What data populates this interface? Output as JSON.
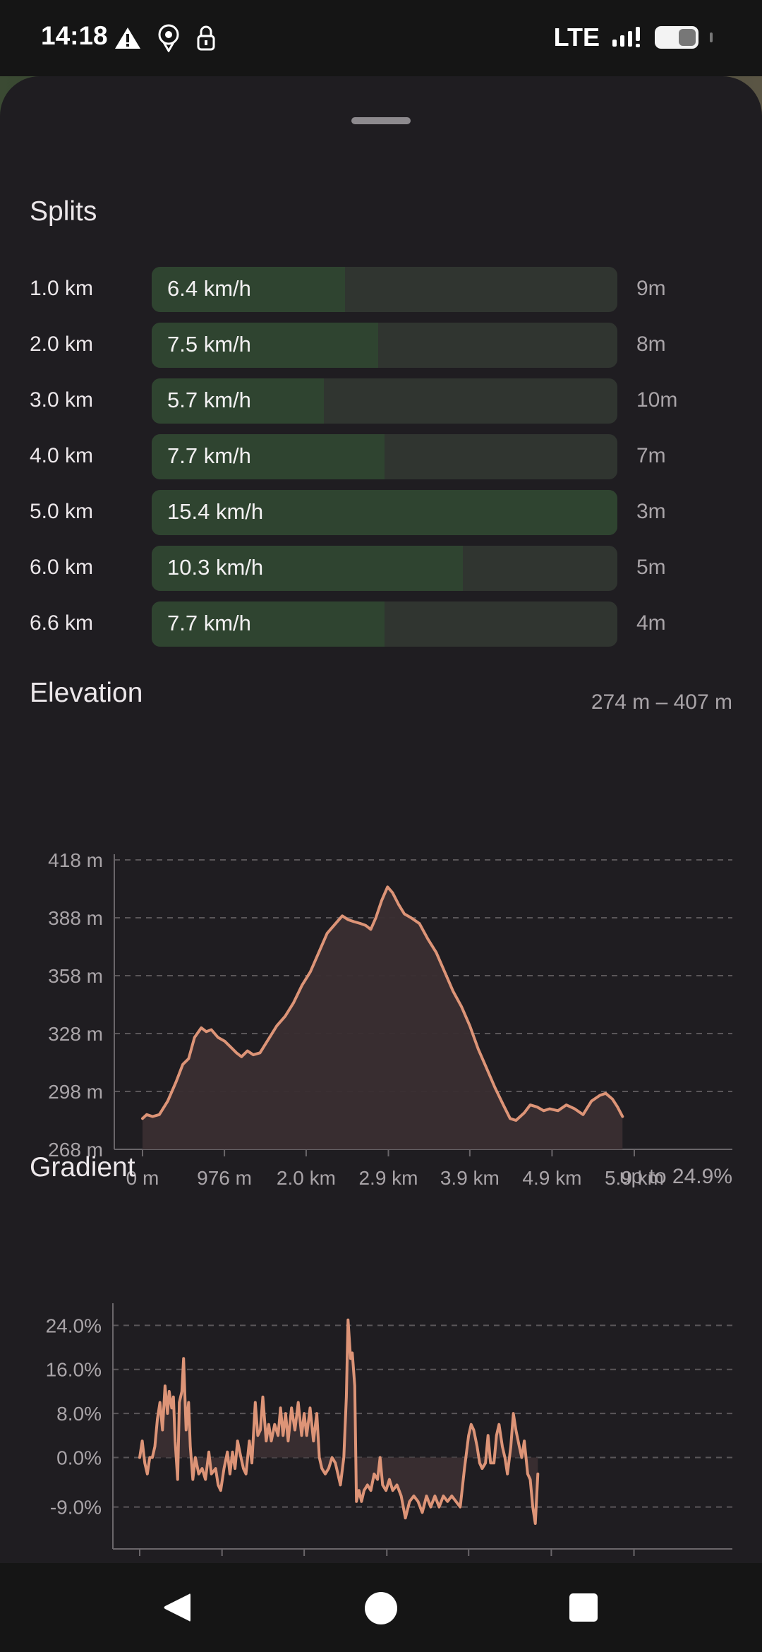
{
  "status_bar": {
    "time": "14:18",
    "icons_left": [
      "warning-icon",
      "location-pin-icon",
      "lock-icon"
    ],
    "network": "LTE",
    "icons_right": [
      "signal-icon",
      "battery-icon"
    ]
  },
  "splits": {
    "title": "Splits",
    "max_speed_kmh": 15.4,
    "rows": [
      {
        "distance": "1.0 km",
        "speed": "6.4 km/h",
        "speed_value": 6.4,
        "time": "9m"
      },
      {
        "distance": "2.0 km",
        "speed": "7.5 km/h",
        "speed_value": 7.5,
        "time": "8m"
      },
      {
        "distance": "3.0 km",
        "speed": "5.7 km/h",
        "speed_value": 5.7,
        "time": "10m"
      },
      {
        "distance": "4.0 km",
        "speed": "7.7 km/h",
        "speed_value": 7.7,
        "time": "7m"
      },
      {
        "distance": "5.0 km",
        "speed": "15.4 km/h",
        "speed_value": 15.4,
        "time": "3m"
      },
      {
        "distance": "6.0 km",
        "speed": "10.3 km/h",
        "speed_value": 10.3,
        "time": "5m"
      },
      {
        "distance": "6.6 km",
        "speed": "7.7 km/h",
        "speed_value": 7.7,
        "time": "4m"
      }
    ]
  },
  "elevation": {
    "title": "Elevation",
    "range": "274 m – 407 m"
  },
  "gradient": {
    "title": "Gradient",
    "summary": "up to 24.9%"
  },
  "chart_data": [
    {
      "type": "area",
      "title": "Elevation",
      "ylim": [
        268,
        418
      ],
      "xlim": [
        0,
        6.6
      ],
      "grid": true,
      "y_ticks": [
        "418 m",
        "388 m",
        "358 m",
        "328 m",
        "298 m",
        "268 m"
      ],
      "y_tick_values": [
        418,
        388,
        358,
        328,
        298,
        268
      ],
      "x_ticks": [
        "0 m",
        "976 m",
        "2.0 km",
        "2.9 km",
        "3.9 km",
        "4.9 km",
        "5.9 km"
      ],
      "x_tick_values": [
        0,
        0.976,
        1.95,
        2.93,
        3.9,
        4.88,
        5.86
      ],
      "x_units": "km",
      "color": "#dd9477",
      "points": [
        [
          0,
          284
        ],
        [
          0.05,
          286
        ],
        [
          0.12,
          285
        ],
        [
          0.2,
          286
        ],
        [
          0.3,
          293
        ],
        [
          0.4,
          303
        ],
        [
          0.48,
          312
        ],
        [
          0.55,
          315
        ],
        [
          0.62,
          326
        ],
        [
          0.7,
          331
        ],
        [
          0.76,
          329
        ],
        [
          0.82,
          330
        ],
        [
          0.9,
          326
        ],
        [
          0.98,
          324
        ],
        [
          1.05,
          321
        ],
        [
          1.12,
          318
        ],
        [
          1.18,
          316
        ],
        [
          1.25,
          319
        ],
        [
          1.32,
          317
        ],
        [
          1.4,
          318
        ],
        [
          1.5,
          325
        ],
        [
          1.6,
          332
        ],
        [
          1.7,
          337
        ],
        [
          1.8,
          344
        ],
        [
          1.9,
          353
        ],
        [
          2.0,
          360
        ],
        [
          2.1,
          370
        ],
        [
          2.2,
          380
        ],
        [
          2.3,
          385
        ],
        [
          2.38,
          389
        ],
        [
          2.45,
          387
        ],
        [
          2.52,
          386
        ],
        [
          2.6,
          385
        ],
        [
          2.66,
          384
        ],
        [
          2.72,
          382
        ],
        [
          2.78,
          388
        ],
        [
          2.85,
          397
        ],
        [
          2.92,
          404
        ],
        [
          2.98,
          401
        ],
        [
          3.05,
          395
        ],
        [
          3.12,
          390
        ],
        [
          3.2,
          388
        ],
        [
          3.3,
          385
        ],
        [
          3.4,
          377
        ],
        [
          3.5,
          370
        ],
        [
          3.6,
          360
        ],
        [
          3.7,
          350
        ],
        [
          3.8,
          342
        ],
        [
          3.9,
          332
        ],
        [
          4.0,
          320
        ],
        [
          4.1,
          310
        ],
        [
          4.2,
          300
        ],
        [
          4.3,
          291
        ],
        [
          4.38,
          284
        ],
        [
          4.45,
          283
        ],
        [
          4.55,
          287
        ],
        [
          4.62,
          291
        ],
        [
          4.7,
          290
        ],
        [
          4.78,
          288
        ],
        [
          4.85,
          289
        ],
        [
          4.95,
          288
        ],
        [
          5.05,
          291
        ],
        [
          5.15,
          289
        ],
        [
          5.25,
          286
        ],
        [
          5.35,
          293
        ],
        [
          5.45,
          296
        ],
        [
          5.52,
          297
        ],
        [
          5.6,
          294
        ],
        [
          5.66,
          290
        ],
        [
          5.72,
          285
        ]
      ]
    },
    {
      "type": "area",
      "title": "Gradient",
      "ylim": [
        -12,
        27
      ],
      "xlim": [
        0,
        6.6
      ],
      "grid": true,
      "y_ticks": [
        "24.0%",
        "16.0%",
        "8.0%",
        "0.0%",
        "-9.0%"
      ],
      "y_tick_values": [
        24,
        16,
        8,
        0,
        -9
      ],
      "x_ticks": [],
      "x_tick_values": [
        0,
        0.976,
        1.95,
        2.93,
        3.9,
        4.88,
        5.86
      ],
      "x_units": "km",
      "color": "#dd9477",
      "points": [
        [
          0,
          0
        ],
        [
          0.03,
          3
        ],
        [
          0.06,
          -1
        ],
        [
          0.09,
          -3
        ],
        [
          0.12,
          0
        ],
        [
          0.15,
          0
        ],
        [
          0.18,
          2
        ],
        [
          0.21,
          7
        ],
        [
          0.24,
          10
        ],
        [
          0.27,
          5
        ],
        [
          0.3,
          13
        ],
        [
          0.33,
          8
        ],
        [
          0.35,
          12
        ],
        [
          0.38,
          9
        ],
        [
          0.4,
          11
        ],
        [
          0.42,
          3
        ],
        [
          0.45,
          -4
        ],
        [
          0.47,
          10
        ],
        [
          0.5,
          12
        ],
        [
          0.52,
          18
        ],
        [
          0.55,
          5
        ],
        [
          0.58,
          10
        ],
        [
          0.6,
          2
        ],
        [
          0.63,
          -4
        ],
        [
          0.66,
          0
        ],
        [
          0.7,
          -3
        ],
        [
          0.74,
          -2
        ],
        [
          0.78,
          -4
        ],
        [
          0.82,
          1
        ],
        [
          0.85,
          -3
        ],
        [
          0.9,
          -2
        ],
        [
          0.93,
          -5
        ],
        [
          0.96,
          -6
        ],
        [
          1.0,
          -2
        ],
        [
          1.04,
          1
        ],
        [
          1.07,
          -3
        ],
        [
          1.1,
          1
        ],
        [
          1.13,
          -2
        ],
        [
          1.16,
          3
        ],
        [
          1.2,
          0
        ],
        [
          1.23,
          -2
        ],
        [
          1.26,
          -3
        ],
        [
          1.3,
          3
        ],
        [
          1.33,
          -1
        ],
        [
          1.37,
          10
        ],
        [
          1.4,
          4
        ],
        [
          1.43,
          5
        ],
        [
          1.46,
          11
        ],
        [
          1.5,
          3
        ],
        [
          1.53,
          6
        ],
        [
          1.56,
          3
        ],
        [
          1.6,
          6
        ],
        [
          1.64,
          4
        ],
        [
          1.67,
          9
        ],
        [
          1.7,
          4
        ],
        [
          1.73,
          8
        ],
        [
          1.76,
          3
        ],
        [
          1.8,
          9
        ],
        [
          1.84,
          5
        ],
        [
          1.88,
          10
        ],
        [
          1.92,
          4
        ],
        [
          1.95,
          8
        ],
        [
          1.98,
          4
        ],
        [
          2.02,
          9
        ],
        [
          2.06,
          3
        ],
        [
          2.1,
          8
        ],
        [
          2.13,
          0
        ],
        [
          2.16,
          -2
        ],
        [
          2.2,
          -3
        ],
        [
          2.24,
          -2
        ],
        [
          2.28,
          0
        ],
        [
          2.32,
          -1
        ],
        [
          2.35,
          -3
        ],
        [
          2.38,
          -5
        ],
        [
          2.42,
          0
        ],
        [
          2.45,
          11
        ],
        [
          2.47,
          25
        ],
        [
          2.5,
          18
        ],
        [
          2.52,
          19
        ],
        [
          2.55,
          13
        ],
        [
          2.57,
          -8
        ],
        [
          2.6,
          -6
        ],
        [
          2.63,
          -8
        ],
        [
          2.66,
          -6
        ],
        [
          2.7,
          -5
        ],
        [
          2.74,
          -6
        ],
        [
          2.78,
          -3
        ],
        [
          2.82,
          -4
        ],
        [
          2.85,
          0
        ],
        [
          2.88,
          -5
        ],
        [
          2.92,
          -6
        ],
        [
          2.96,
          -4
        ],
        [
          3.0,
          -6
        ],
        [
          3.05,
          -5
        ],
        [
          3.1,
          -7
        ],
        [
          3.15,
          -11
        ],
        [
          3.2,
          -8
        ],
        [
          3.25,
          -7
        ],
        [
          3.3,
          -8
        ],
        [
          3.35,
          -10
        ],
        [
          3.4,
          -7
        ],
        [
          3.45,
          -9
        ],
        [
          3.5,
          -7
        ],
        [
          3.55,
          -9
        ],
        [
          3.6,
          -7
        ],
        [
          3.65,
          -8
        ],
        [
          3.7,
          -7
        ],
        [
          3.75,
          -8
        ],
        [
          3.8,
          -9
        ],
        [
          3.85,
          -2
        ],
        [
          3.9,
          4
        ],
        [
          3.93,
          6
        ],
        [
          3.96,
          5
        ],
        [
          4.0,
          2
        ],
        [
          4.03,
          -1
        ],
        [
          4.06,
          -2
        ],
        [
          4.1,
          -1
        ],
        [
          4.13,
          4
        ],
        [
          4.16,
          -1
        ],
        [
          4.2,
          -1
        ],
        [
          4.23,
          4
        ],
        [
          4.26,
          6
        ],
        [
          4.3,
          2
        ],
        [
          4.33,
          0
        ],
        [
          4.36,
          -3
        ],
        [
          4.4,
          2
        ],
        [
          4.43,
          8
        ],
        [
          4.46,
          5
        ],
        [
          4.5,
          2
        ],
        [
          4.53,
          0
        ],
        [
          4.56,
          3
        ],
        [
          4.6,
          -3
        ],
        [
          4.63,
          -4
        ],
        [
          4.66,
          -9
        ],
        [
          4.69,
          -12
        ],
        [
          4.72,
          -3
        ]
      ]
    }
  ],
  "nav": {
    "icons": [
      "back-icon",
      "home-icon",
      "recents-icon"
    ]
  }
}
